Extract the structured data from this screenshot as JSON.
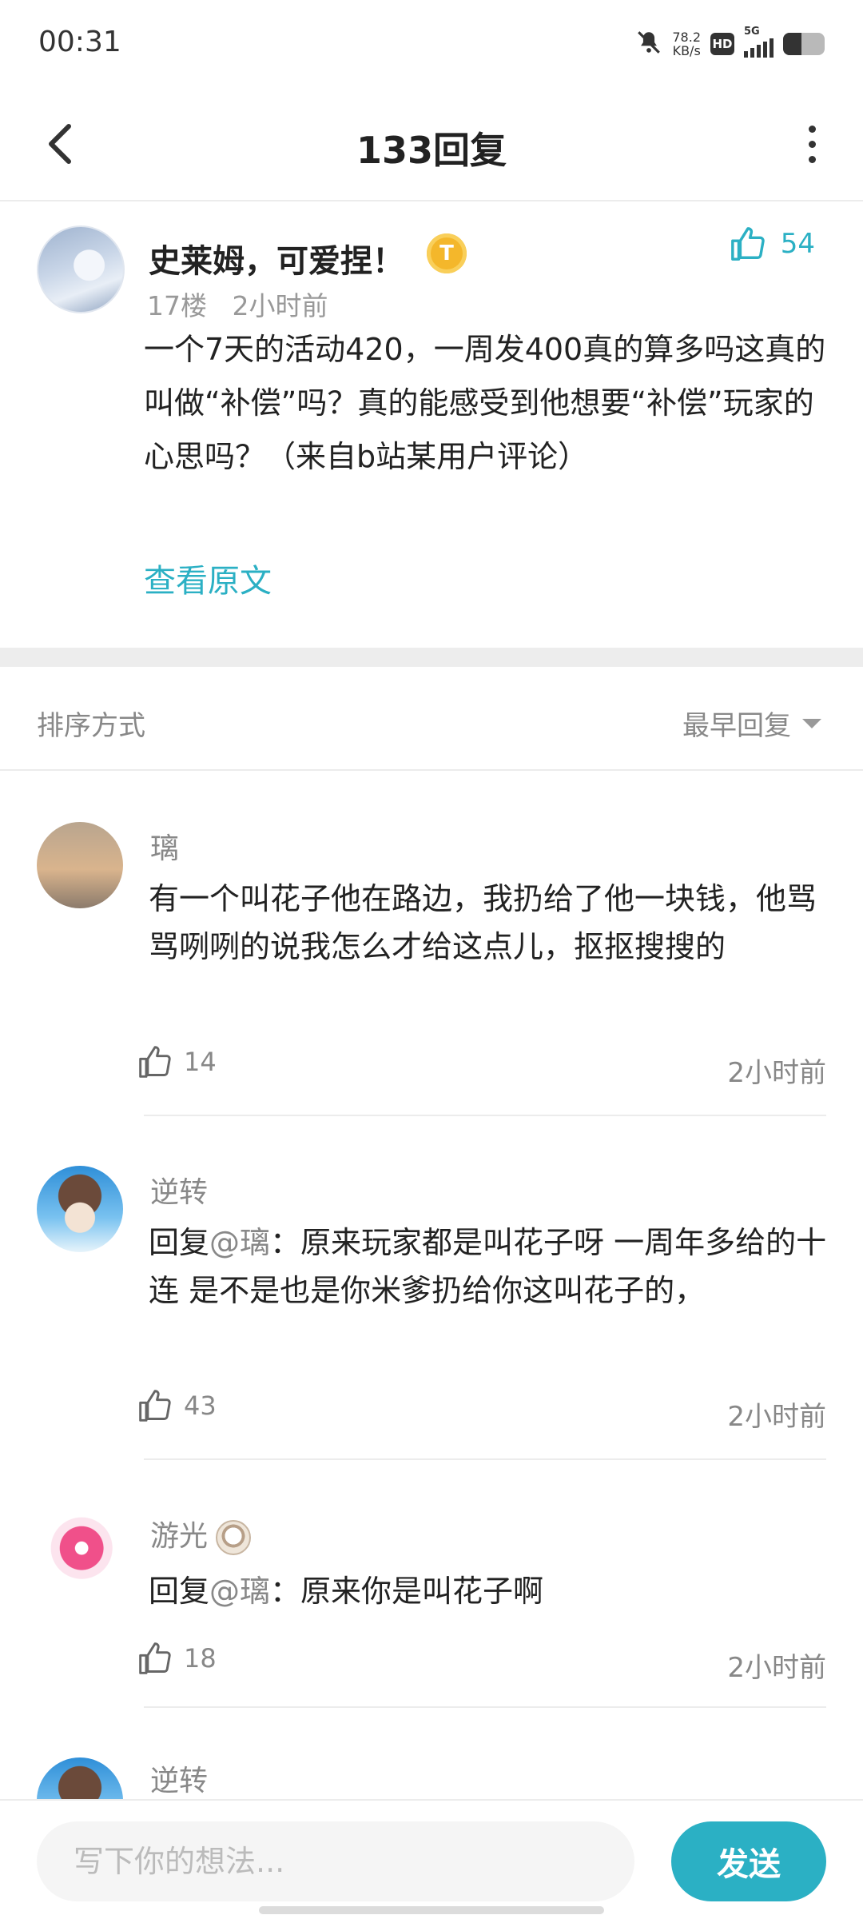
{
  "status_bar": {
    "time": "00:31",
    "net_speed_value": "78.2",
    "net_speed_unit": "KB/s",
    "hd_label": "HD",
    "signal_label": "5G",
    "battery_level": 0.45,
    "icons": [
      "mute-icon",
      "signal-icon",
      "battery-icon"
    ]
  },
  "header": {
    "title": "133回复",
    "back_icon": "chevron-left-icon",
    "more_icon": "more-vertical-icon"
  },
  "post": {
    "username": "史莱姆，可爱捏！",
    "badge_letter": "T",
    "floor": "17楼",
    "time": "2小时前",
    "likes": "54",
    "text": "一个7天的活动420，一周发400真的算多吗这真的叫做“补偿”吗？真的能感受到他想要“补偿”玩家的心思吗？（来自b站某用户评论）",
    "view_original": "查看原文"
  },
  "sort": {
    "label": "排序方式",
    "selected": "最早回复"
  },
  "replies": [
    {
      "username": "璃",
      "text": "有一个叫花子他在路边，我扔给了他一块钱，他骂骂咧咧的说我怎么才给这点儿，抠抠搜搜的",
      "likes": "14",
      "time": "2小时前"
    },
    {
      "username": "逆转",
      "reply_prefix": "回复",
      "mention": "@璃",
      "text": "：原来玩家都是叫花子呀 一周年多给的十连 是不是也是你米爹扔给你这叫花子的，",
      "likes": "43",
      "time": "2小时前"
    },
    {
      "username": "游光",
      "reply_prefix": "回复",
      "mention": "@璃",
      "text": "：原来你是叫花子啊",
      "likes": "18",
      "time": "2小时前"
    },
    {
      "username": "逆转"
    }
  ],
  "composer": {
    "placeholder": "写下你的想法...",
    "send_label": "发送"
  },
  "colors": {
    "accent": "#2bb0c4",
    "text_primary": "#222222",
    "text_secondary": "#888888"
  }
}
